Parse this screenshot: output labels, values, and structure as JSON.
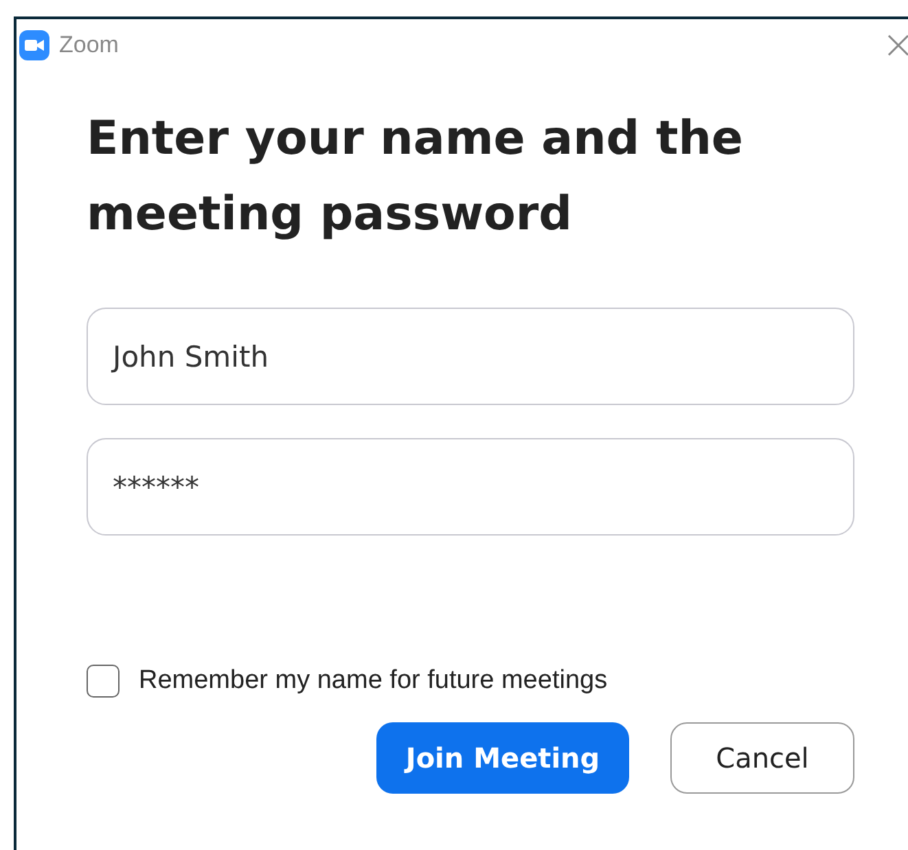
{
  "window": {
    "title": "Zoom"
  },
  "heading": "Enter your name and the meeting password",
  "fields": [
    {
      "value": "John Smith"
    },
    {
      "value": "******"
    }
  ],
  "remember": {
    "label": "Remember my name for future meetings",
    "checked": false
  },
  "buttons": [
    {
      "label": "Join Meeting",
      "kind": "primary"
    },
    {
      "label": "Cancel",
      "kind": "secondary"
    }
  ]
}
